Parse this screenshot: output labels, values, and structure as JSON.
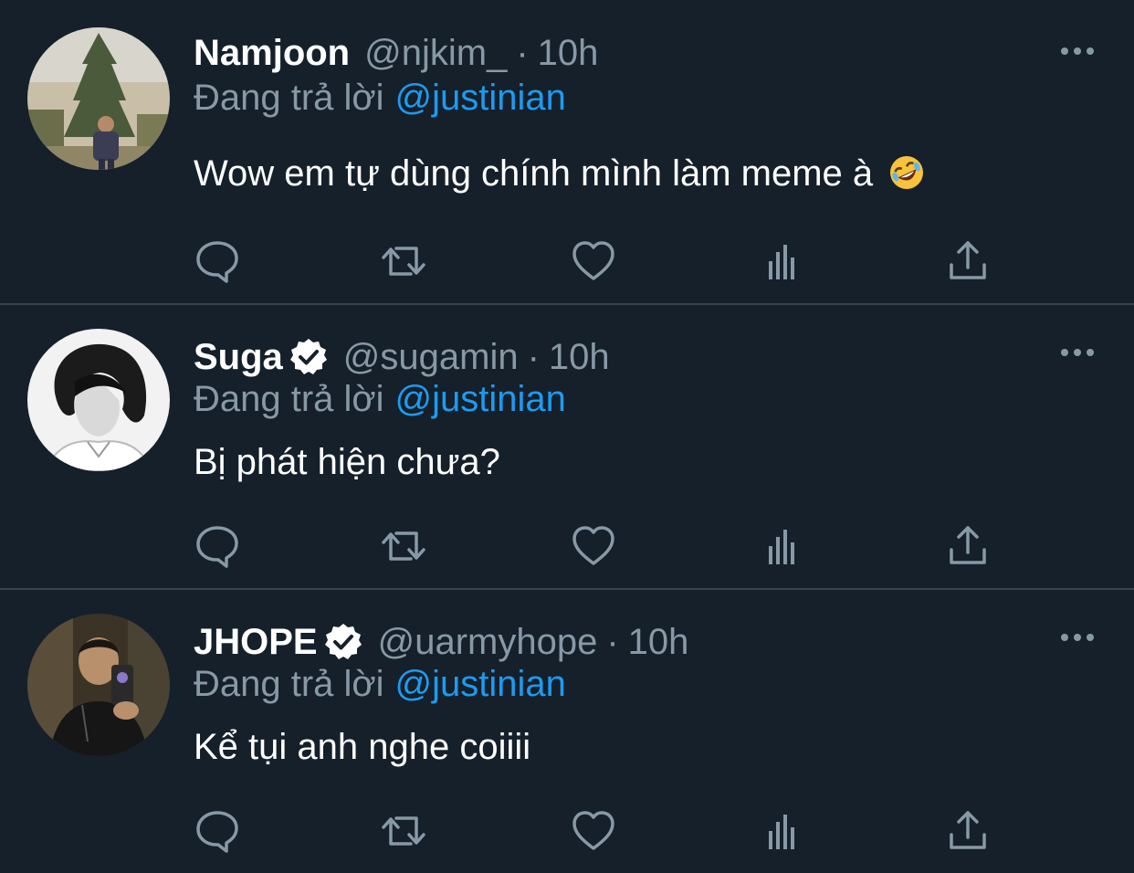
{
  "colors": {
    "background": "#15202b",
    "muted": "#8899a6",
    "accent": "#1d9bf0",
    "divider": "#38444d"
  },
  "tweets": [
    {
      "name": "Namjoon",
      "verified": false,
      "handle": "@njkim_",
      "separator": "·",
      "time": "10h",
      "reply_prefix": "Đang trả lời",
      "reply_to": "@justinian",
      "text": "Wow em tự dùng chính mình làm meme à",
      "emoji": "rolling-on-floor-laughing"
    },
    {
      "name": "Suga",
      "verified": true,
      "handle": "@sugamin",
      "separator": "·",
      "time": "10h",
      "reply_prefix": "Đang trả lời",
      "reply_to": "@justinian",
      "text": "Bị phát hiện chưa?"
    },
    {
      "name": "JHOPE",
      "verified": true,
      "handle": "@uarmyhope",
      "separator": "·",
      "time": "10h",
      "reply_prefix": "Đang trả lời",
      "reply_to": "@justinian",
      "text": "Kể tụi anh nghe coiiii"
    }
  ],
  "action_icons": [
    "reply-icon",
    "retweet-icon",
    "like-icon",
    "views-icon",
    "share-icon"
  ]
}
